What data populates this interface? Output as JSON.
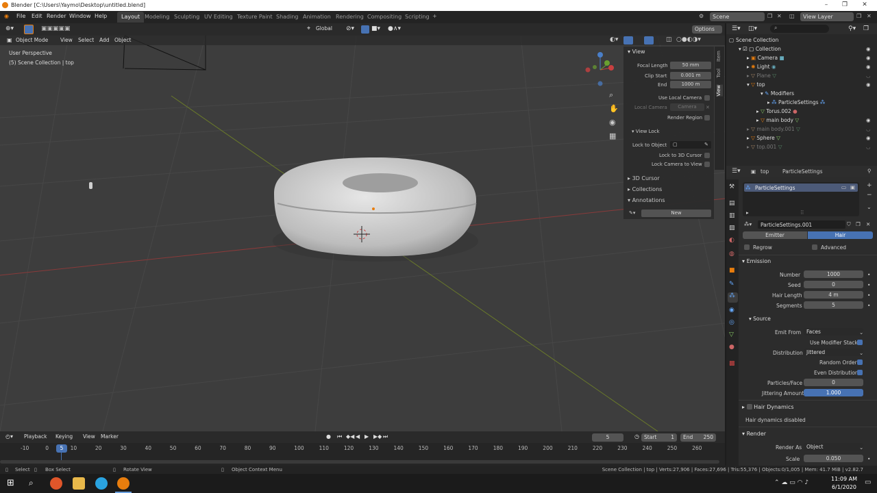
{
  "titlebar": {
    "title": "Blender [C:\\Users\\Yaymo\\Desktop\\untitled.blend]"
  },
  "menu": {
    "items": [
      "File",
      "Edit",
      "Render",
      "Window",
      "Help"
    ]
  },
  "workspaces": [
    "Layout",
    "Modeling",
    "Sculpting",
    "UV Editing",
    "Texture Paint",
    "Shading",
    "Animation",
    "Rendering",
    "Compositing",
    "Scripting"
  ],
  "topbar": {
    "scene": "Scene",
    "view_layer": "View Layer"
  },
  "viewport_toolbar": {
    "orientation": "Global",
    "options": "Options"
  },
  "viewport_header": {
    "mode": "Object Mode",
    "menus": [
      "View",
      "Select",
      "Add",
      "Object"
    ]
  },
  "viewport_overlay": {
    "line1": "User Perspective",
    "line2": "(5) Scene Collection | top"
  },
  "npanel": {
    "tabs": [
      "Item",
      "Tool",
      "View"
    ],
    "view_label": "View",
    "focal_length_label": "Focal Length",
    "focal_length": "50 mm",
    "clip_start_label": "Clip Start",
    "clip_start": "0.001 m",
    "end_label": "End",
    "end": "1000 m",
    "use_local_camera": "Use Local Camera",
    "local_camera_label": "Local Camera",
    "local_camera": "Camera",
    "render_region": "Render Region",
    "view_lock": "View Lock",
    "lock_to_object": "Lock to Object",
    "lock_to_3d_cursor": "Lock to 3D Cursor",
    "lock_camera_to_view": "Lock Camera to View",
    "cursor3d": "3D Cursor",
    "collections": "Collections",
    "annotations": "Annotations",
    "new": "New"
  },
  "outliner": {
    "root": "Scene Collection",
    "items": [
      {
        "label": "Collection"
      },
      {
        "label": "Camera"
      },
      {
        "label": "Light"
      },
      {
        "label": "Plane"
      },
      {
        "label": "top"
      },
      {
        "label": "Modifiers"
      },
      {
        "label": "ParticleSettings"
      },
      {
        "label": "Torus.002"
      },
      {
        "label": "main body"
      },
      {
        "label": "main body.001"
      },
      {
        "label": "Sphere"
      },
      {
        "label": "top.001"
      }
    ]
  },
  "properties": {
    "breadcrumb_object": "top",
    "breadcrumb_system": "ParticleSettings",
    "system_list_item": "ParticleSettings",
    "settings_name": "ParticleSettings.001",
    "emitter": "Emitter",
    "hair": "Hair",
    "regrow": "Regrow",
    "advanced": "Advanced",
    "emission": "Emission",
    "number_label": "Number",
    "number": "1000",
    "seed_label": "Seed",
    "seed": "0",
    "hair_length_label": "Hair Length",
    "hair_length": "4 m",
    "segments_label": "Segments",
    "segments": "5",
    "source": "Source",
    "emit_from_label": "Emit From",
    "emit_from": "Faces",
    "use_modifier_stack": "Use Modifier Stack",
    "distribution_label": "Distribution",
    "distribution": "Jittered",
    "random_order": "Random Order",
    "even_distribution": "Even Distribution",
    "particles_face_label": "Particles/Face",
    "particles_face": "0",
    "jittering_label": "Jittering Amount",
    "jittering": "1.000",
    "hair_dynamics": "Hair Dynamics",
    "hair_dynamics_disabled": "Hair dynamics disabled",
    "render": "Render",
    "render_as_label": "Render As",
    "render_as": "Object",
    "scale_label": "Scale",
    "scale": "0.050"
  },
  "timeline": {
    "menus": [
      "Playback",
      "Keying",
      "View",
      "Marker"
    ],
    "current_frame": "5",
    "start_label": "Start",
    "start": "1",
    "end_label": "End",
    "end": "250",
    "ticks": [
      "-10",
      "0",
      "10",
      "20",
      "30",
      "40",
      "50",
      "60",
      "70",
      "80",
      "90",
      "100",
      "110",
      "120",
      "130",
      "140",
      "150",
      "160",
      "170",
      "180",
      "190",
      "200",
      "210",
      "220",
      "230",
      "240",
      "250",
      "260"
    ],
    "playhead": "5"
  },
  "statusbar": {
    "select": "Select",
    "box_select": "Box Select",
    "rotate_view": "Rotate View",
    "context_menu": "Object Context Menu",
    "stats": "Scene Collection | top | Verts:27,906 | Faces:27,696 | Tris:55,376 | Objects:0/1,005 | Mem: 41.7 MiB | v2.82.7"
  },
  "taskbar": {
    "time": "11:09 AM",
    "date": "6/1/2020"
  },
  "colors": {
    "accent": "#4772b3",
    "active_orange": "#e87d0d"
  }
}
